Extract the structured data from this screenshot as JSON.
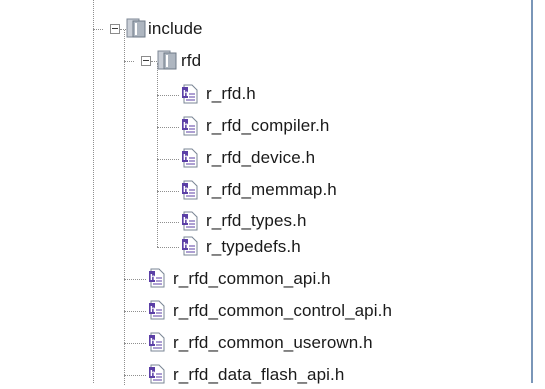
{
  "tree": {
    "include": {
      "label": "include",
      "icon": "folder-icon",
      "expanded": true
    },
    "rfd": {
      "label": "rfd",
      "icon": "folder-icon",
      "expanded": true,
      "files": [
        "r_rfd.h",
        "r_rfd_compiler.h",
        "r_rfd_device.h",
        "r_rfd_memmap.h",
        "r_rfd_types.h",
        "r_typedefs.h"
      ]
    },
    "include_files": [
      "r_rfd_common_api.h",
      "r_rfd_common_control_api.h",
      "r_rfd_common_userown.h",
      "r_rfd_data_flash_api.h"
    ]
  },
  "colors": {
    "border": "#7a96b8",
    "file_icon_accent": "#5b3fa6",
    "folder_icon": "#9aa4b0"
  }
}
